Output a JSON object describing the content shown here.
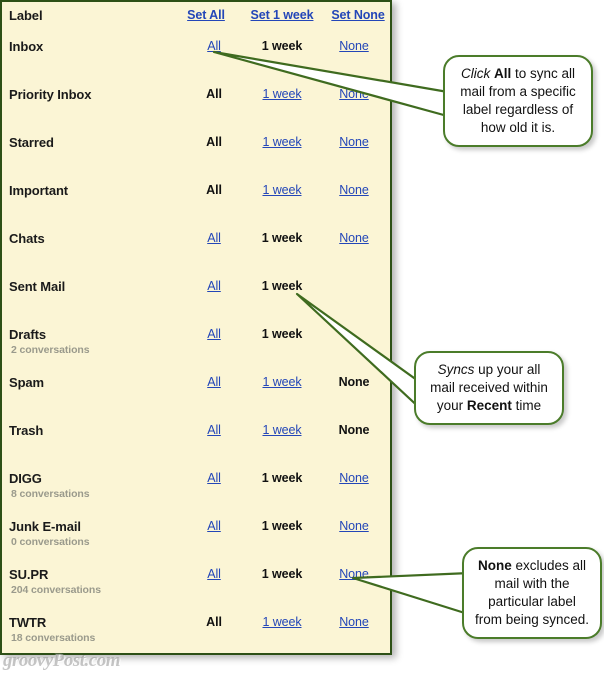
{
  "panel": {
    "header": {
      "label_column": "Label",
      "set_all": "Set All",
      "set_week": "Set 1 week",
      "set_none": "Set None"
    },
    "option_labels": {
      "all": "All",
      "week": "1 week",
      "none": "None"
    },
    "rows": [
      {
        "name": "Inbox",
        "sub": "",
        "all": "link",
        "week": "active",
        "none": "link"
      },
      {
        "name": "Priority Inbox",
        "sub": "",
        "all": "active",
        "week": "link",
        "none": "link"
      },
      {
        "name": "Starred",
        "sub": "",
        "all": "active",
        "week": "link",
        "none": "link"
      },
      {
        "name": "Important",
        "sub": "",
        "all": "active",
        "week": "link",
        "none": "link"
      },
      {
        "name": "Chats",
        "sub": "",
        "all": "link",
        "week": "active",
        "none": "link"
      },
      {
        "name": "Sent Mail",
        "sub": "",
        "all": "link",
        "week": "active",
        "none": "hidden"
      },
      {
        "name": "Drafts",
        "sub": "2 conversations",
        "all": "link",
        "week": "active",
        "none": "hidden"
      },
      {
        "name": "Spam",
        "sub": "",
        "all": "link",
        "week": "link",
        "none": "active"
      },
      {
        "name": "Trash",
        "sub": "",
        "all": "link",
        "week": "link",
        "none": "active"
      },
      {
        "name": "DIGG",
        "sub": "8 conversations",
        "all": "link",
        "week": "active",
        "none": "link"
      },
      {
        "name": "Junk E-mail",
        "sub": "0 conversations",
        "all": "link",
        "week": "active",
        "none": "link"
      },
      {
        "name": "SU.PR",
        "sub": "204 conversations",
        "all": "link",
        "week": "active",
        "none": "link"
      },
      {
        "name": "TWTR",
        "sub": "18 conversations",
        "all": "active",
        "week": "link",
        "none": "link"
      }
    ]
  },
  "callouts": [
    {
      "id": "callout-1",
      "parts": [
        {
          "text": "Click ",
          "style": "italic"
        },
        {
          "text": "All",
          "style": "bold"
        },
        {
          "text": " to sync all mail from a specific label regardless of how old it is.",
          "style": "normal"
        }
      ]
    },
    {
      "id": "callout-2",
      "parts": [
        {
          "text": "Syncs",
          "style": "italic"
        },
        {
          "text": " up your all mail received within your ",
          "style": "normal"
        },
        {
          "text": "Recent",
          "style": "bold"
        },
        {
          "text": " time",
          "style": "normal"
        }
      ]
    },
    {
      "id": "callout-3",
      "parts": [
        {
          "text": "None",
          "style": "bold"
        },
        {
          "text": " excludes all mail with the particular label from being synced.",
          "style": "normal"
        }
      ]
    }
  ],
  "watermark": "groovyPost.com",
  "colors": {
    "panel_background": "#fbf5d5",
    "panel_border": "#2d5016",
    "link": "#2346b8",
    "active_text": "#111111",
    "subtext": "#9a9a8c",
    "callout_border": "#4b7c2a",
    "arrow_stroke": "#3f6b1f"
  }
}
